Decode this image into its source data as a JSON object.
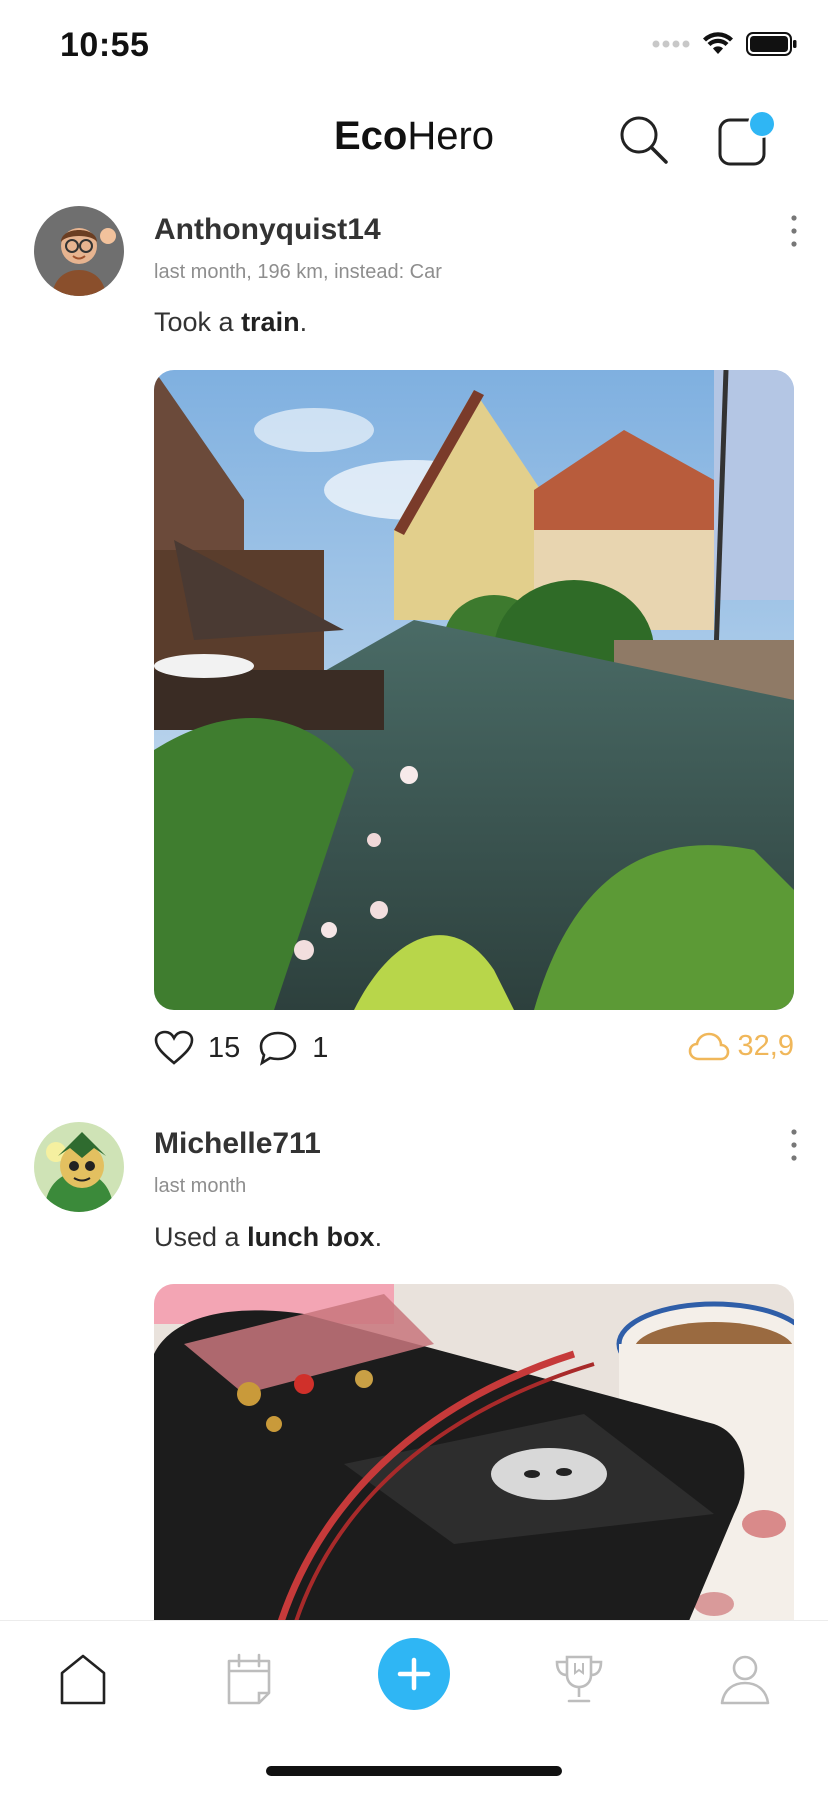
{
  "status": {
    "time": "10:55"
  },
  "header": {
    "brand_bold": "Eco",
    "brand_light": "Hero"
  },
  "posts": [
    {
      "username": "Anthonyquist14",
      "meta": "last month, 196 km, instead: Car",
      "caption_prefix": "Took a ",
      "caption_bold": "train",
      "caption_suffix": ".",
      "likes": "15",
      "comments": "1",
      "co2": "32,9"
    },
    {
      "username": "Michelle711",
      "meta": "last month",
      "caption_prefix": "Used a ",
      "caption_bold": "lunch box",
      "caption_suffix": "."
    }
  ],
  "tabs": [
    {
      "name": "home",
      "icon": "home-icon",
      "active": true
    },
    {
      "name": "calendar",
      "icon": "calendar-icon"
    },
    {
      "name": "add",
      "icon": "plus-icon"
    },
    {
      "name": "trophy",
      "icon": "trophy-icon"
    },
    {
      "name": "profile",
      "icon": "profile-icon"
    }
  ],
  "colors": {
    "accent": "#2fb6f4",
    "co2": "#f0b75a",
    "icon_inactive": "#bdbdbd"
  }
}
